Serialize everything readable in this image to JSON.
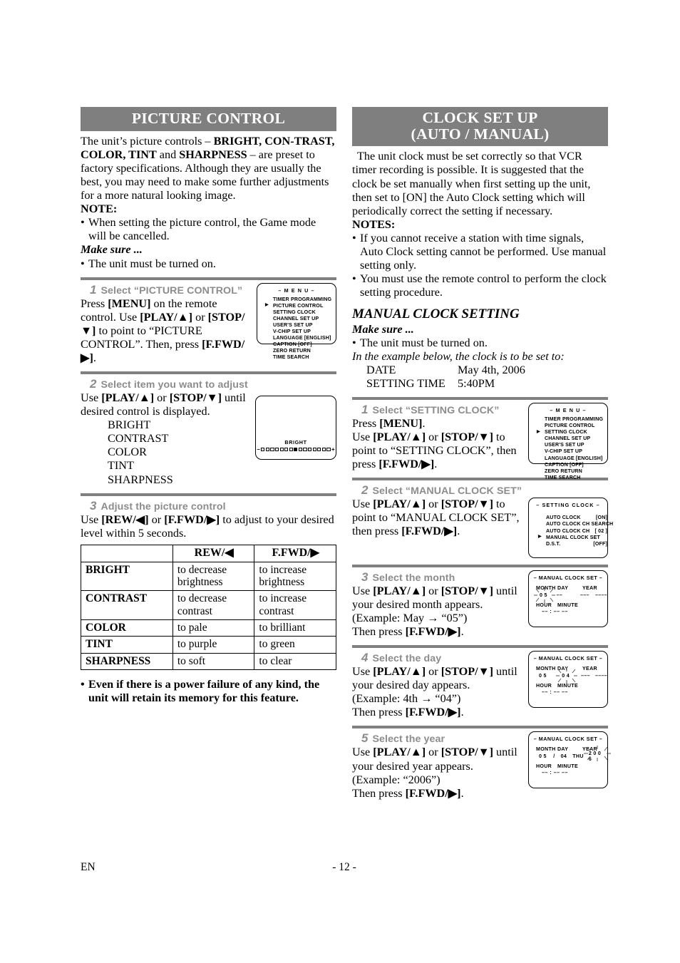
{
  "left": {
    "banner": "PICTURE CONTROL",
    "intro": {
      "line1_a": "The unit’s picture controls – ",
      "line1_b": "BRIGHT, CON-TRAST, COLOR, TINT",
      "line1_c": " and ",
      "line1_d": "SHARPNESS",
      "line1_e": " – are preset to factory specifications. Although they are usually the best, you may need to make some further adjustments for a more natural looking image.",
      "note_label": "NOTE:",
      "note_bullet": "When setting the picture control, the Game mode will be cancelled.",
      "make_sure": "Make sure ...",
      "make_sure_bullet": "The unit must be turned on."
    },
    "step1": {
      "num": "1",
      "title": "Select “PICTURE CONTROL”",
      "l1_a": "Press ",
      "l1_b": "[MENU]",
      "l1_c": " on the remote control.",
      "l2_a": "Use ",
      "l2_b": "[PLAY/▲]",
      "l2_c": " or ",
      "l2_d": "[STOP/▼]",
      "l2_e": " to point to “PICTURE CONTROL”.",
      "l3_a": "Then, press ",
      "l3_b": "[F.FWD/▶]",
      "l3_c": "."
    },
    "menu_osd": {
      "title": "– M E N U –",
      "items": [
        {
          "label": "TIMER PROGRAMMING",
          "value": "",
          "selected": false
        },
        {
          "label": "PICTURE CONTROL",
          "value": "",
          "selected": true
        },
        {
          "label": "SETTING CLOCK",
          "value": "",
          "selected": false
        },
        {
          "label": "CHANNEL SET UP",
          "value": "",
          "selected": false
        },
        {
          "label": "USER'S SET UP",
          "value": "",
          "selected": false
        },
        {
          "label": "V-CHIP SET UP",
          "value": "",
          "selected": false
        },
        {
          "label": "LANGUAGE  [ENGLISH]",
          "value": "",
          "selected": false
        },
        {
          "label": "CAPTION  [OFF]",
          "value": "",
          "selected": false
        },
        {
          "label": "ZERO RETURN",
          "value": "",
          "selected": false
        },
        {
          "label": "TIME SEARCH",
          "value": "",
          "selected": false
        }
      ]
    },
    "step2": {
      "num": "2",
      "title": "Select item you want to adjust",
      "l1_a": "Use ",
      "l1_b": "[PLAY/▲]",
      "l1_c": " or ",
      "l1_d": "[STOP/▼]",
      "l1_e": " until desired control is displayed.",
      "items": [
        "BRIGHT",
        "CONTRAST",
        "COLOR",
        "TINT",
        "SHARPNESS"
      ]
    },
    "bright_osd": {
      "label": "BRIGHT",
      "minus": "–",
      "plus": "+",
      "total_cells": 15,
      "active_index": 7
    },
    "step3": {
      "num": "3",
      "title": "Adjust the picture control",
      "l1_a": "Use ",
      "l1_b": "[REW/◀]",
      "l1_c": " or ",
      "l1_d": "[F.FWD/▶]",
      "l1_e": " to adjust to your desired level within 5 seconds."
    },
    "table": {
      "headers": [
        "",
        "REW/◀",
        "F.FWD/▶"
      ],
      "rows": [
        [
          "BRIGHT",
          "to decrease brightness",
          "to increase brightness"
        ],
        [
          "CONTRAST",
          "to decrease contrast",
          "to increase contrast"
        ],
        [
          "COLOR",
          "to pale",
          "to brilliant"
        ],
        [
          "TINT",
          "to purple",
          "to green"
        ],
        [
          "SHARPNESS",
          "to soft",
          "to clear"
        ]
      ]
    },
    "closing_bullet": "Even if there is a power failure of any kind, the unit will retain its memory for this feature."
  },
  "right": {
    "banner_line1": "CLOCK SET UP",
    "banner_line2": "(AUTO / MANUAL)",
    "intro": "The unit clock must be set correctly so that VCR timer recording is possible. It is suggested that the clock be set manually when first setting up the unit, then set to [ON] the Auto Clock setting which will periodically correct the setting if necessary.",
    "notes_label": "NOTES:",
    "notes": [
      "If you cannot receive a station with time signals, Auto Clock setting cannot be performed. Use manual setting only.",
      "You must use the remote control to perform the clock setting procedure."
    ],
    "subhead": "MANUAL CLOCK SETTING",
    "make_sure": "Make sure ...",
    "make_sure_bullet": "The unit must be turned on.",
    "example_lead": "In the example below, the clock is to be set to:",
    "example_rows": [
      {
        "label": "DATE",
        "value": "May 4th, 2006"
      },
      {
        "label": "SETTING TIME",
        "value": "5:40PM"
      }
    ],
    "step1": {
      "num": "1",
      "title": "Select “SETTING CLOCK”",
      "l1_a": "Press ",
      "l1_b": "[MENU]",
      "l1_c": ".",
      "l2_a": "Use ",
      "l2_b": "[PLAY/▲]",
      "l2_c": " or ",
      "l2_d": "[STOP/▼]",
      "l2_e": " to point to “SETTING CLOCK”, then press ",
      "l2_f": "[F.FWD/▶]",
      "l2_g": "."
    },
    "menu_osd": {
      "title": "– M E N U –",
      "items": [
        {
          "label": "TIMER PROGRAMMING",
          "selected": false
        },
        {
          "label": "PICTURE CONTROL",
          "selected": false
        },
        {
          "label": "SETTING CLOCK",
          "selected": true
        },
        {
          "label": "CHANNEL SET UP",
          "selected": false
        },
        {
          "label": "USER'S SET UP",
          "selected": false
        },
        {
          "label": "V-CHIP SET UP",
          "selected": false
        },
        {
          "label": "LANGUAGE  [ENGLISH]",
          "selected": false
        },
        {
          "label": "CAPTION  [OFF]",
          "selected": false
        },
        {
          "label": "ZERO RETURN",
          "selected": false
        },
        {
          "label": "TIME SEARCH",
          "selected": false
        }
      ]
    },
    "step2": {
      "num": "2",
      "title": "Select “MANUAL CLOCK SET”",
      "l1_a": "Use ",
      "l1_b": "[PLAY/▲]",
      "l1_c": " or ",
      "l1_d": "[STOP/▼]",
      "l1_e": " to point to “MANUAL CLOCK SET”, then press ",
      "l1_f": "[F.FWD/▶]",
      "l1_g": "."
    },
    "setclock_osd": {
      "title": "– SETTING CLOCK –",
      "items": [
        {
          "label": "AUTO CLOCK",
          "value": "[ON]",
          "selected": false
        },
        {
          "label": "AUTO CLOCK CH SEARCH",
          "value": "",
          "selected": false
        },
        {
          "label": "AUTO CLOCK CH",
          "value": "[ 02 ]",
          "selected": false
        },
        {
          "label": "MANUAL CLOCK SET",
          "value": "",
          "selected": true
        },
        {
          "label": "D.S.T.",
          "value": "[OFF]",
          "selected": false
        }
      ]
    },
    "step3": {
      "num": "3",
      "title": "Select the month",
      "l1_a": "Use ",
      "l1_b": "[PLAY/▲]",
      "l1_c": " or ",
      "l1_d": "[STOP/▼]",
      "l1_e": " until your desired month appears.",
      "l2": "(Example: May → “05”)",
      "l3_a": "Then press ",
      "l3_b": "[F.FWD/▶]",
      "l3_c": "."
    },
    "step4": {
      "num": "4",
      "title": "Select the day",
      "l1_a": "Use ",
      "l1_b": "[PLAY/▲]",
      "l1_c": " or ",
      "l1_d": "[STOP/▼]",
      "l1_e": " until your desired day appears.",
      "l2": "(Example: 4th → “04”)",
      "l3_a": "Then press ",
      "l3_b": "[F.FWD/▶]",
      "l3_c": "."
    },
    "step5": {
      "num": "5",
      "title": "Select the year",
      "l1_a": "Use ",
      "l1_b": "[PLAY/▲]",
      "l1_c": " or ",
      "l1_d": "[STOP/▼]",
      "l1_e": " until your desired year appears.",
      "l2": "(Example: “2006”)",
      "l3_a": "Then press ",
      "l3_b": "[F.FWD/▶]",
      "l3_c": "."
    },
    "mcs_osd": {
      "title": "– MANUAL CLOCK SET –",
      "hdr_month": "MONTH",
      "hdr_day": "DAY",
      "hdr_year": "YEAR",
      "hdr_hour": "HOUR",
      "hdr_minute": "MINUTE",
      "blank2": "––",
      "blank3": "–––",
      "blank4": "––––",
      "time_row": "–– : ––  ––",
      "sep": "/",
      "step3_values": {
        "month": "0 5",
        "day": "––",
        "weekday": "–––",
        "year": "––––",
        "blink": "month"
      },
      "step4_values": {
        "month": "0 5",
        "day": "0 4",
        "weekday": "–––",
        "year": "––––",
        "blink": "day"
      },
      "step5_values": {
        "month": "0 5",
        "day": "04",
        "weekday": "THU",
        "year": "2 0 0 6",
        "blink": "year"
      }
    }
  },
  "footer": {
    "lang": "EN",
    "page": "- 12 -"
  }
}
